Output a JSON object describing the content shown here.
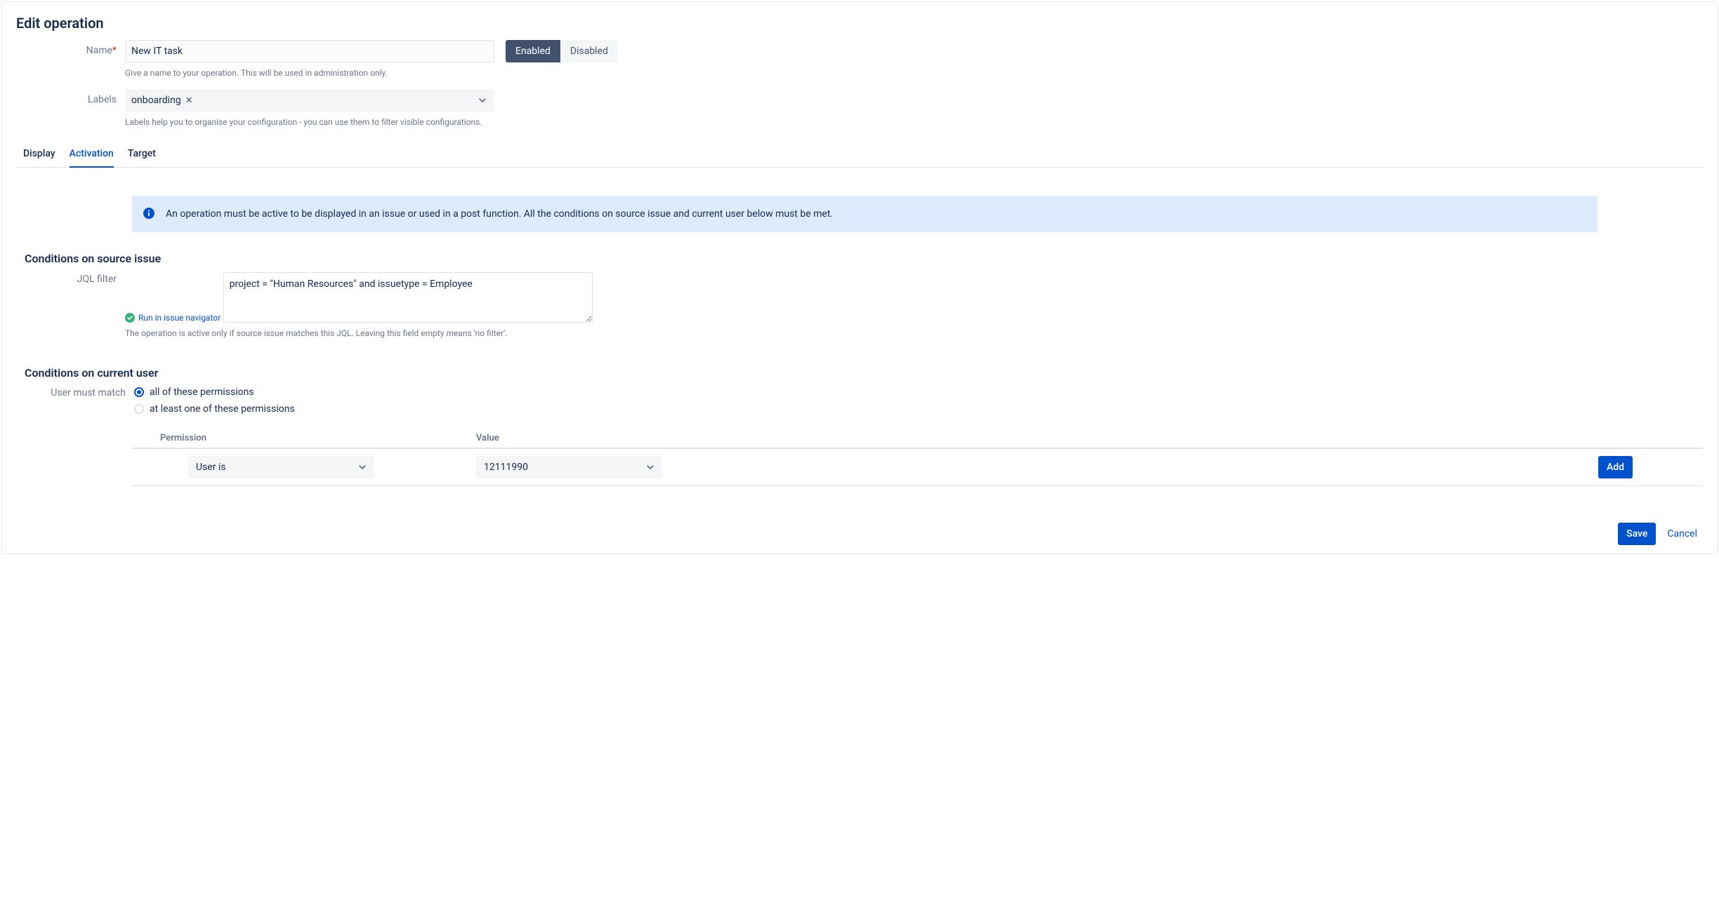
{
  "pageTitle": "Edit operation",
  "nameField": {
    "label": "Name",
    "value": "New IT task",
    "help": "Give a name to your operation. This will be used in administration only."
  },
  "statusToggle": {
    "enabled": "Enabled",
    "disabled": "Disabled",
    "active": "enabled"
  },
  "labelsField": {
    "label": "Labels",
    "chip": "onboarding",
    "help": "Labels help you to organise your configuration - you can use them to filter visible configurations."
  },
  "tabs": {
    "display": "Display",
    "activation": "Activation",
    "target": "Target"
  },
  "infoBanner": "An operation must be active to be displayed in an issue or used in a post function. All the conditions on source issue and current user below must be met.",
  "sourceSection": {
    "title": "Conditions on source issue",
    "jqlLabel": "JQL filter",
    "runLink": "Run in issue navigator",
    "jqlValue": "project = \"Human Resources\" and issuetype = Employee",
    "jqlHelp": "The operation is active only if source issue matches this JQL. Leaving this field empty means 'no filter'."
  },
  "userSection": {
    "title": "Conditions on current user",
    "matchLabel": "User must match",
    "optionAll": "all of these permissions",
    "optionAny": "at least one of these permissions",
    "selected": "all"
  },
  "permTable": {
    "headerPermission": "Permission",
    "headerValue": "Value",
    "row": {
      "permission": "User is",
      "value": "12111990"
    },
    "addButton": "Add"
  },
  "footer": {
    "save": "Save",
    "cancel": "Cancel"
  }
}
